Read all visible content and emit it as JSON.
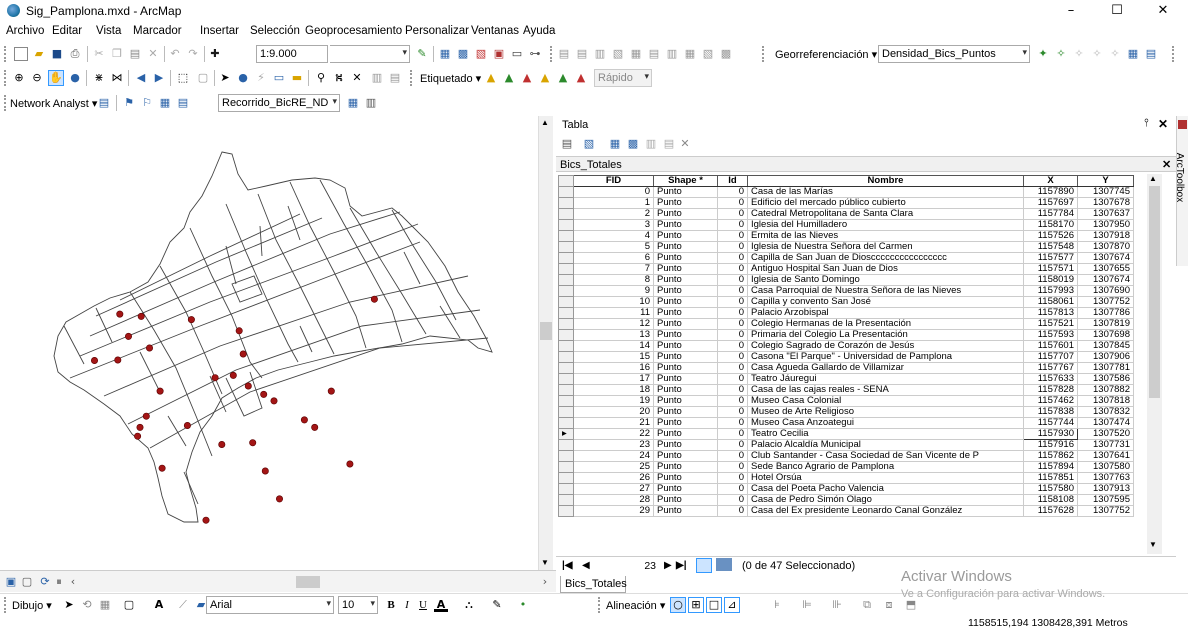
{
  "window": {
    "title": "Sig_Pamplona.mxd - ArcMap",
    "minimize": "–",
    "maximize": "☐",
    "close": "✕"
  },
  "menu": [
    "Archivo",
    "Editar",
    "Vista",
    "Marcador",
    "Insertar",
    "Selección",
    "Geoprocesamiento",
    "Personalizar",
    "Ventanas",
    "Ayuda"
  ],
  "toolbar": {
    "scale": "1:9.000",
    "georef_label": "Georreferenciación ▾",
    "georef_layer": "Densidad_Bics_Puntos",
    "etiquetado_label": "Etiquetado ▾",
    "rapido": "Rápido",
    "network_label": "Network Analyst ▾",
    "network_layer": "Recorrido_BicRE_ND"
  },
  "table_panel": {
    "title": "Tabla",
    "table_name": "Bics_Totales",
    "arctoolbox": "ArcToolbox",
    "columns": [
      "FID",
      "Shape *",
      "Id",
      "Nombre",
      "X",
      "Y"
    ],
    "rows": [
      [
        "0",
        "Punto",
        "0",
        "Casa de las Marías",
        "1157890",
        "1307745"
      ],
      [
        "1",
        "Punto",
        "0",
        "Edificio del mercado público cubierto",
        "1157697",
        "1307678"
      ],
      [
        "2",
        "Punto",
        "0",
        "Catedral Metropolitana de Santa Clara",
        "1157784",
        "1307637"
      ],
      [
        "3",
        "Punto",
        "0",
        "Iglesia del Humilladero",
        "1158170",
        "1307950"
      ],
      [
        "4",
        "Punto",
        "0",
        "Ermita de las Nieves",
        "1157526",
        "1307918"
      ],
      [
        "5",
        "Punto",
        "0",
        "Iglesia de Nuestra Señora del Carmen",
        "1157548",
        "1307870"
      ],
      [
        "6",
        "Punto",
        "0",
        "Capilla de San Juan de Dioscccccccccccccccc",
        "1157577",
        "1307674"
      ],
      [
        "7",
        "Punto",
        "0",
        "Antiguo Hospital San Juan de Dios",
        "1157571",
        "1307655"
      ],
      [
        "8",
        "Punto",
        "0",
        "Iglesia de Santo Domingo",
        "1158019",
        "1307674"
      ],
      [
        "9",
        "Punto",
        "0",
        "Casa Parroquial de Nuestra Señora de las Nieves",
        "1157993",
        "1307690"
      ],
      [
        "10",
        "Punto",
        "0",
        "Capilla y convento San José",
        "1158061",
        "1307752"
      ],
      [
        "11",
        "Punto",
        "0",
        "Palacio Arzobispal",
        "1157813",
        "1307786"
      ],
      [
        "12",
        "Punto",
        "0",
        "Colegio Hermanas de la Presentación",
        "1157521",
        "1307819"
      ],
      [
        "13",
        "Punto",
        "0",
        "Primaria del Colegio La Presentación",
        "1157593",
        "1307698"
      ],
      [
        "14",
        "Punto",
        "0",
        "Colegio Sagrado de Corazón de Jesús",
        "1157601",
        "1307845"
      ],
      [
        "15",
        "Punto",
        "0",
        "Casona \"El Parque\" - Universidad de Pamplona",
        "1157707",
        "1307906"
      ],
      [
        "16",
        "Punto",
        "0",
        "Casa Águeda Gallardo de Villamizar",
        "1157767",
        "1307781"
      ],
      [
        "17",
        "Punto",
        "0",
        "Teatro Jáuregui",
        "1157633",
        "1307586"
      ],
      [
        "18",
        "Punto",
        "0",
        "Casa de las cajas reales - SENA",
        "1157828",
        "1307882"
      ],
      [
        "19",
        "Punto",
        "0",
        "Museo Casa Colonial",
        "1157462",
        "1307818"
      ],
      [
        "20",
        "Punto",
        "0",
        "Museo de Arte Religioso",
        "1157838",
        "1307832"
      ],
      [
        "21",
        "Punto",
        "0",
        "Museo Casa Anzoategui",
        "1157744",
        "1307474"
      ],
      [
        "22",
        "Punto",
        "0",
        "Teatro Cecilia",
        "1157930",
        "1307520"
      ],
      [
        "23",
        "Punto",
        "0",
        "Palacio Alcaldía Municipal",
        "1157916",
        "1307731"
      ],
      [
        "24",
        "Punto",
        "0",
        "Club Santander - Casa Sociedad de San Vicente de P",
        "1157862",
        "1307641"
      ],
      [
        "25",
        "Punto",
        "0",
        "Sede Banco Agrario de Pamplona",
        "1157894",
        "1307580"
      ],
      [
        "26",
        "Punto",
        "0",
        "Hotel Orsúa",
        "1157851",
        "1307763"
      ],
      [
        "27",
        "Punto",
        "0",
        "Casa del Poeta Pacho Valencia",
        "1157580",
        "1307913"
      ],
      [
        "28",
        "Punto",
        "0",
        "Casa de Pedro Simón Olago",
        "1158108",
        "1307595"
      ],
      [
        "29",
        "Punto",
        "0",
        "Casa del Ex presidente Leonardo Canal González",
        "1157628",
        "1307752"
      ]
    ],
    "current_record": "23",
    "selection_status": "(0 de 47 Seleccionado)",
    "bottom_tab": "Bics_Totales"
  },
  "drawing": {
    "dibujo": "Dibujo ▾",
    "font": "Arial",
    "size": "10",
    "alineacion": "Alineación ▾"
  },
  "status": {
    "coords": "1158515,194  1308428,391 Metros",
    "activate_title": "Activar Windows",
    "activate_sub": "Ve a Configuración para activar Windows."
  },
  "colors": {
    "accent": "#3399ff",
    "point": "#a31515",
    "street": "#444444"
  }
}
